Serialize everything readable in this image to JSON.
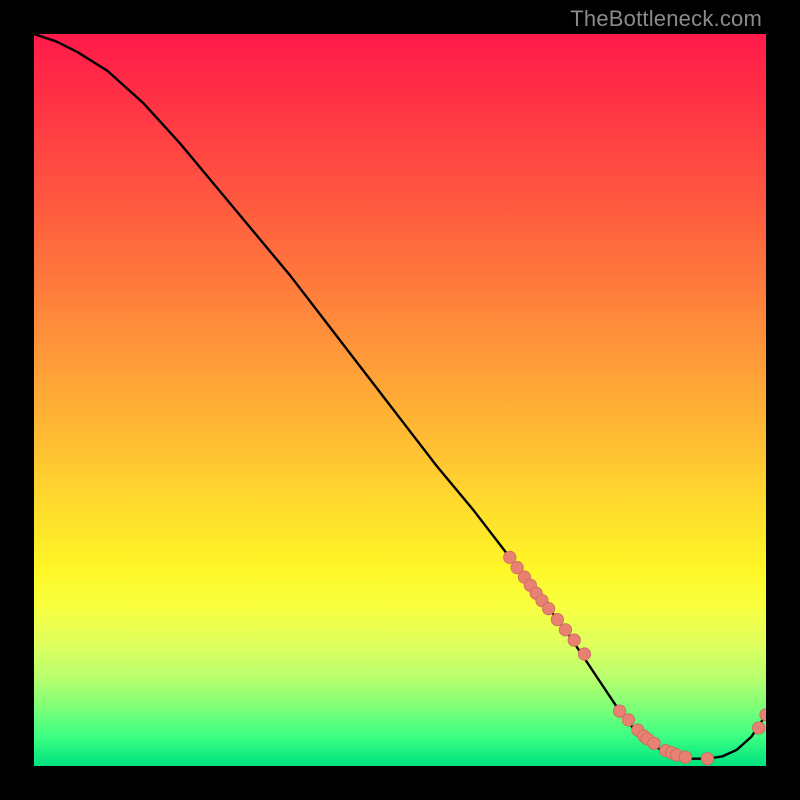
{
  "watermark": {
    "text": "TheBottleneck.com"
  },
  "colors": {
    "curve_stroke": "#000000",
    "marker_fill": "#e98172",
    "marker_stroke": "#c86a5d",
    "gradient_top": "#ff1a4a",
    "gradient_bottom": "#00e27e"
  },
  "chart_data": {
    "type": "line",
    "title": "",
    "xlabel": "",
    "ylabel": "",
    "xlim": [
      0,
      100
    ],
    "ylim": [
      0,
      100
    ],
    "grid": false,
    "legend": false,
    "series": [
      {
        "name": "bottleneck-curve",
        "x": [
          0,
          3,
          6,
          10,
          15,
          20,
          25,
          30,
          35,
          40,
          45,
          50,
          55,
          60,
          65,
          70,
          73,
          75,
          78,
          80,
          82,
          84,
          86,
          88,
          90,
          92,
          94,
          96,
          98,
          100
        ],
        "values": [
          100,
          99,
          97.5,
          95,
          90.5,
          85,
          79,
          73,
          67,
          60.5,
          54,
          47.5,
          41,
          35,
          28.5,
          22,
          18,
          15,
          10.5,
          7.5,
          5,
          3.2,
          2,
          1.2,
          1,
          1,
          1.3,
          2.2,
          4,
          7
        ]
      }
    ],
    "markers": {
      "name": "highlight-points",
      "x": [
        65,
        66,
        67,
        67.8,
        68.6,
        69.4,
        70.3,
        71.5,
        72.6,
        73.8,
        75.2,
        80,
        81.2,
        82.5,
        83.3,
        83.8,
        84.7,
        86.3,
        87.1,
        87.8,
        89,
        92,
        99,
        100
      ],
      "values": [
        28.5,
        27.1,
        25.8,
        24.7,
        23.6,
        22.6,
        21.5,
        20,
        18.6,
        17.2,
        15.3,
        7.5,
        6.3,
        4.9,
        4.1,
        3.7,
        3.1,
        2.1,
        1.8,
        1.5,
        1.2,
        1,
        5.2,
        7
      ]
    }
  }
}
